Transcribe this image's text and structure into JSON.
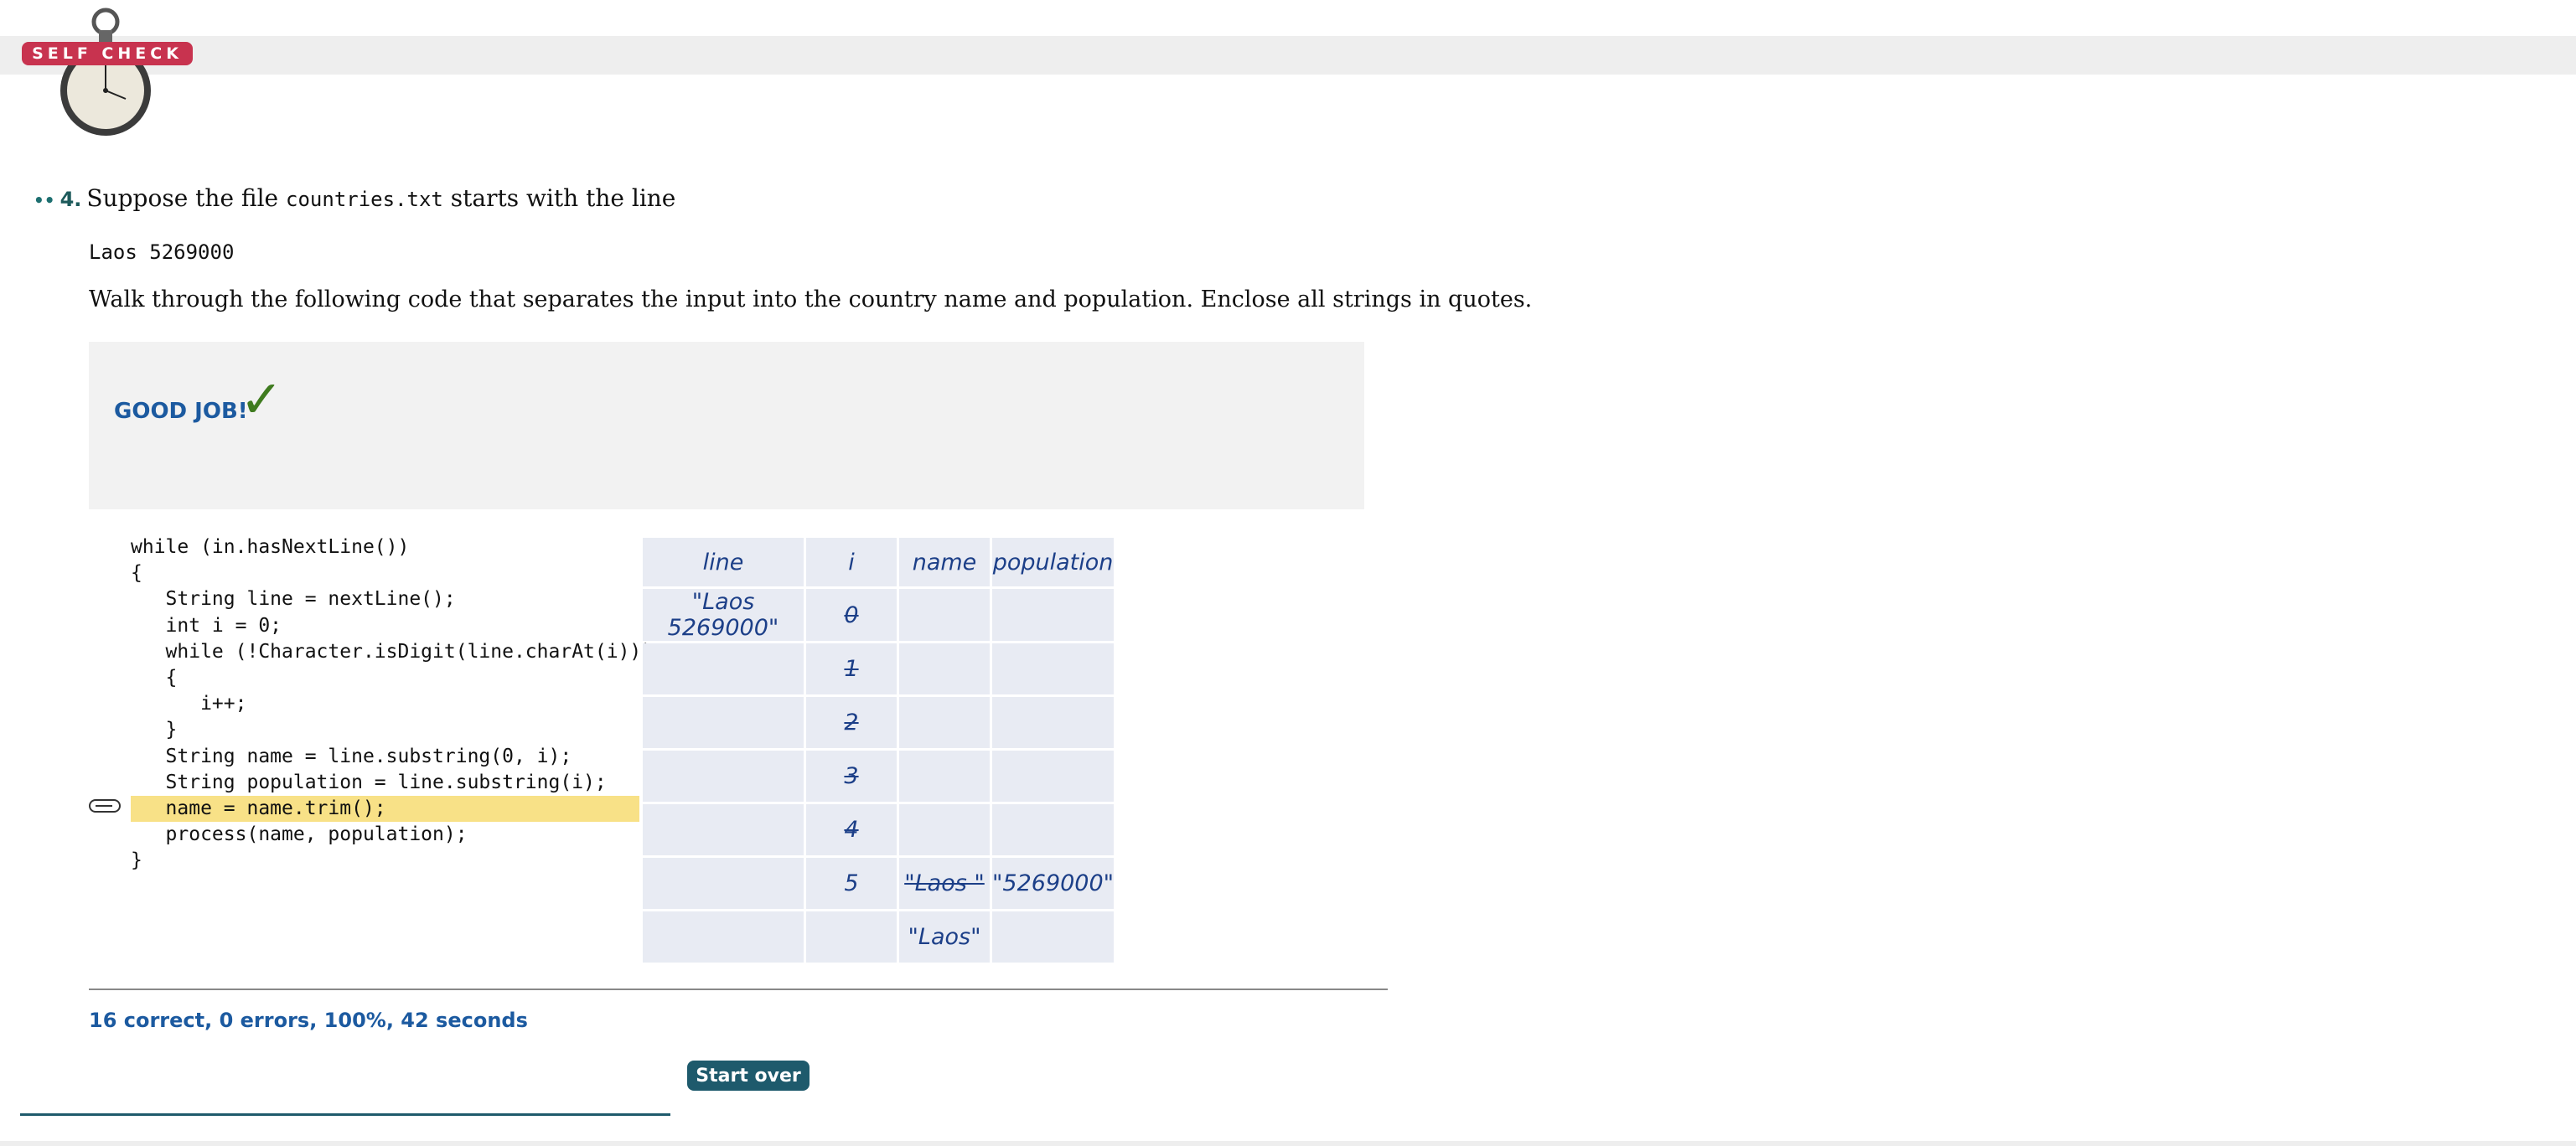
{
  "header": {
    "badge_label": "SELF CHECK"
  },
  "question": {
    "dots": "••",
    "number": "4.",
    "intro": "Suppose the file",
    "filename": "countries.txt",
    "intro_end": "starts with the line",
    "file_line": "Laos 5269000",
    "instruction": "Walk through the following code that separates the input into the country name and population. Enclose all strings in quotes."
  },
  "feedback": {
    "label": "GOOD JOB!",
    "check_icon": "checkmark-icon"
  },
  "code": {
    "lines": [
      "while (in.hasNextLine())",
      "{",
      "   String line = nextLine();",
      "   int i = 0;",
      "   while (!Character.isDigit(line.charAt(i)))",
      "   {",
      "      i++;",
      "   }",
      "   String name = line.substring(0, i);",
      "   String population = line.substring(i);",
      "   name = name.trim();",
      "   process(name, population);",
      "}"
    ],
    "current_line_index": 10
  },
  "trace_table": {
    "headers": [
      "line",
      "i",
      "name",
      "population"
    ],
    "rows": [
      [
        "\"Laos 5269000\"",
        "0",
        "",
        ""
      ],
      [
        "",
        "1",
        "",
        ""
      ],
      [
        "",
        "2",
        "",
        ""
      ],
      [
        "",
        "3",
        "",
        ""
      ],
      [
        "",
        "4",
        "",
        ""
      ],
      [
        "",
        "5",
        "\"Laos \"",
        "\"5269000\""
      ],
      [
        "",
        "",
        "\"Laos\"",
        ""
      ]
    ]
  },
  "result": {
    "score_text": "16 correct, 0 errors, 100%, 42 seconds",
    "start_over_label": "Start over"
  }
}
